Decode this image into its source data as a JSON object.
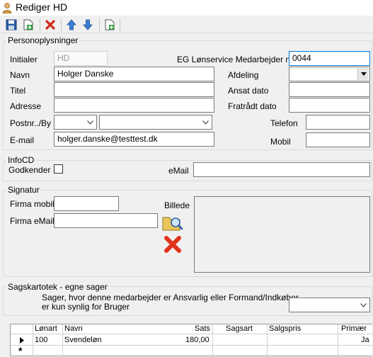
{
  "window": {
    "title": "Rediger HD"
  },
  "toolbar": {
    "buttons": [
      {
        "name": "save",
        "icon": "save-icon"
      },
      {
        "name": "save-new",
        "icon": "save-new-icon"
      },
      {
        "name": "delete",
        "icon": "delete-icon"
      },
      {
        "name": "move-up",
        "icon": "arrow-up-icon"
      },
      {
        "name": "move-down",
        "icon": "arrow-down-icon"
      },
      {
        "name": "new",
        "icon": "new-document-icon"
      }
    ]
  },
  "personal": {
    "legend": "Personoplysninger",
    "initialer_label": "Initialer",
    "initialer_value": "HD",
    "eg_label": "EG Lønservice Medarbejder nr.",
    "eg_value": "0044",
    "navn_label": "Navn",
    "navn_value": "Holger Danske",
    "afdeling_label": "Afdeling",
    "afdeling_value": "",
    "titel_label": "Titel",
    "titel_value": "",
    "ansat_label": "Ansat dato",
    "ansat_value": "",
    "adresse_label": "Adresse",
    "adresse_value": "",
    "fratraadt_label": "Fratrådt dato",
    "fratraadt_value": "",
    "postnr_label": "Postnr../By",
    "postnr_value": "",
    "by_value": "",
    "telefon_label": "Telefon",
    "telefon_value": "",
    "email_label": "E-mail",
    "email_value": "holger.danske@testtest.dk",
    "mobil_label": "Mobil",
    "mobil_value": ""
  },
  "infocd": {
    "legend": "InfoCD",
    "godkender_label": "Godkender",
    "godkender_checked": false,
    "email_label": "eMail",
    "email_value": ""
  },
  "signatur": {
    "legend": "Signatur",
    "firma_mobil_label": "Firma mobil",
    "firma_mobil_value": "",
    "firma_email_label": "Firma eMaill",
    "firma_email_value": "",
    "billede_label": "Billede"
  },
  "sagskartotek": {
    "legend": "Sagskartotek - egne sager",
    "description_line1": "Sager, hvor denne medarbejder er Ansvarlig eller Formand/Indkøber,",
    "description_line2": "er kun synlig for Bruger",
    "select_value": ""
  },
  "grid": {
    "columns": [
      "Lønart",
      "Navn",
      "Sats",
      "Sagsart",
      "Salgspris",
      "Primær"
    ],
    "rows": [
      {
        "lonart": "100",
        "navn": "Svendeløn",
        "sats": "180,00",
        "sagsart": "",
        "salgspris": "",
        "primaer": "Ja"
      }
    ],
    "new_row_marker": "*"
  }
}
